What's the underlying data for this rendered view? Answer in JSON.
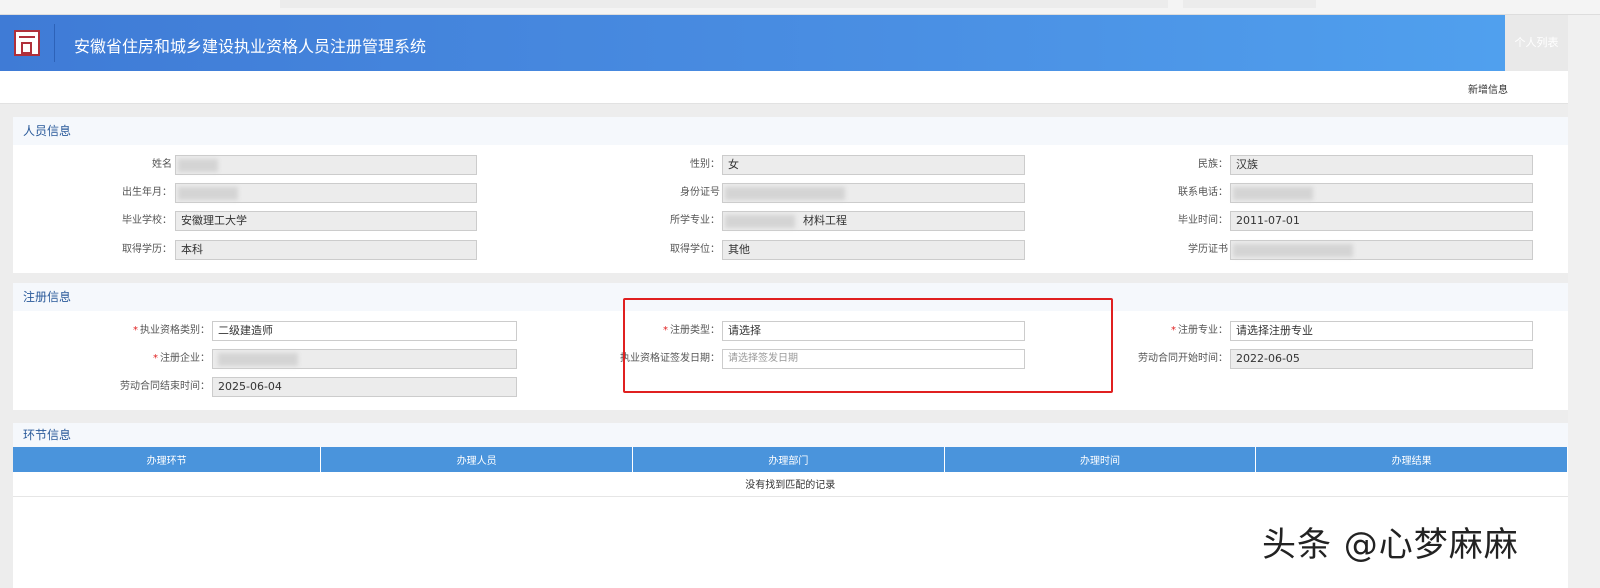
{
  "header": {
    "title": "安徽省住房和城乡建设执业资格人员注册管理系统",
    "personal_list": "个人列表"
  },
  "toolbar": {
    "add_label": "新增信息"
  },
  "personnel": {
    "title": "人员信息",
    "fields": [
      {
        "label": "姓名",
        "value": ""
      },
      {
        "label": "性别：",
        "value": "女"
      },
      {
        "label": "民族：",
        "value": "汉族"
      },
      {
        "label": "出生年月：",
        "value": ""
      },
      {
        "label": "身份证号",
        "value": ""
      },
      {
        "label": "联系电话：",
        "value": ""
      },
      {
        "label": "毕业学校：",
        "value": "安徽理工大学"
      },
      {
        "label": "所学专业：",
        "value": "材料工程"
      },
      {
        "label": "毕业时间：",
        "value": "2011-07-01"
      },
      {
        "label": "取得学历：",
        "value": "本科"
      },
      {
        "label": "取得学位：",
        "value": "其他"
      },
      {
        "label": "学历证书",
        "value": ""
      }
    ]
  },
  "registration": {
    "title": "注册信息",
    "fields": [
      {
        "label": "执业资格类别：",
        "value": "二级建造师",
        "required": true
      },
      {
        "label": "注册类型：",
        "value": "请选择",
        "required": true
      },
      {
        "label": "注册专业：",
        "value": "请选择注册专业",
        "required": true
      },
      {
        "label": "注册企业：",
        "value": "",
        "required": true
      },
      {
        "label": "执业资格证签发日期：",
        "placeholder": "请选择签发日期"
      },
      {
        "label": "劳动合同开始时间：",
        "value": "2022-06-05"
      },
      {
        "label": "劳动合同结束时间：",
        "value": "2025-06-04"
      }
    ],
    "required_mark": "*"
  },
  "process": {
    "title": "环节信息",
    "columns": [
      "办理环节",
      "办理人员",
      "办理部门",
      "办理时间",
      "办理结果"
    ],
    "empty_text": "没有找到匹配的记录"
  },
  "watermark": "头条 @心梦麻麻"
}
